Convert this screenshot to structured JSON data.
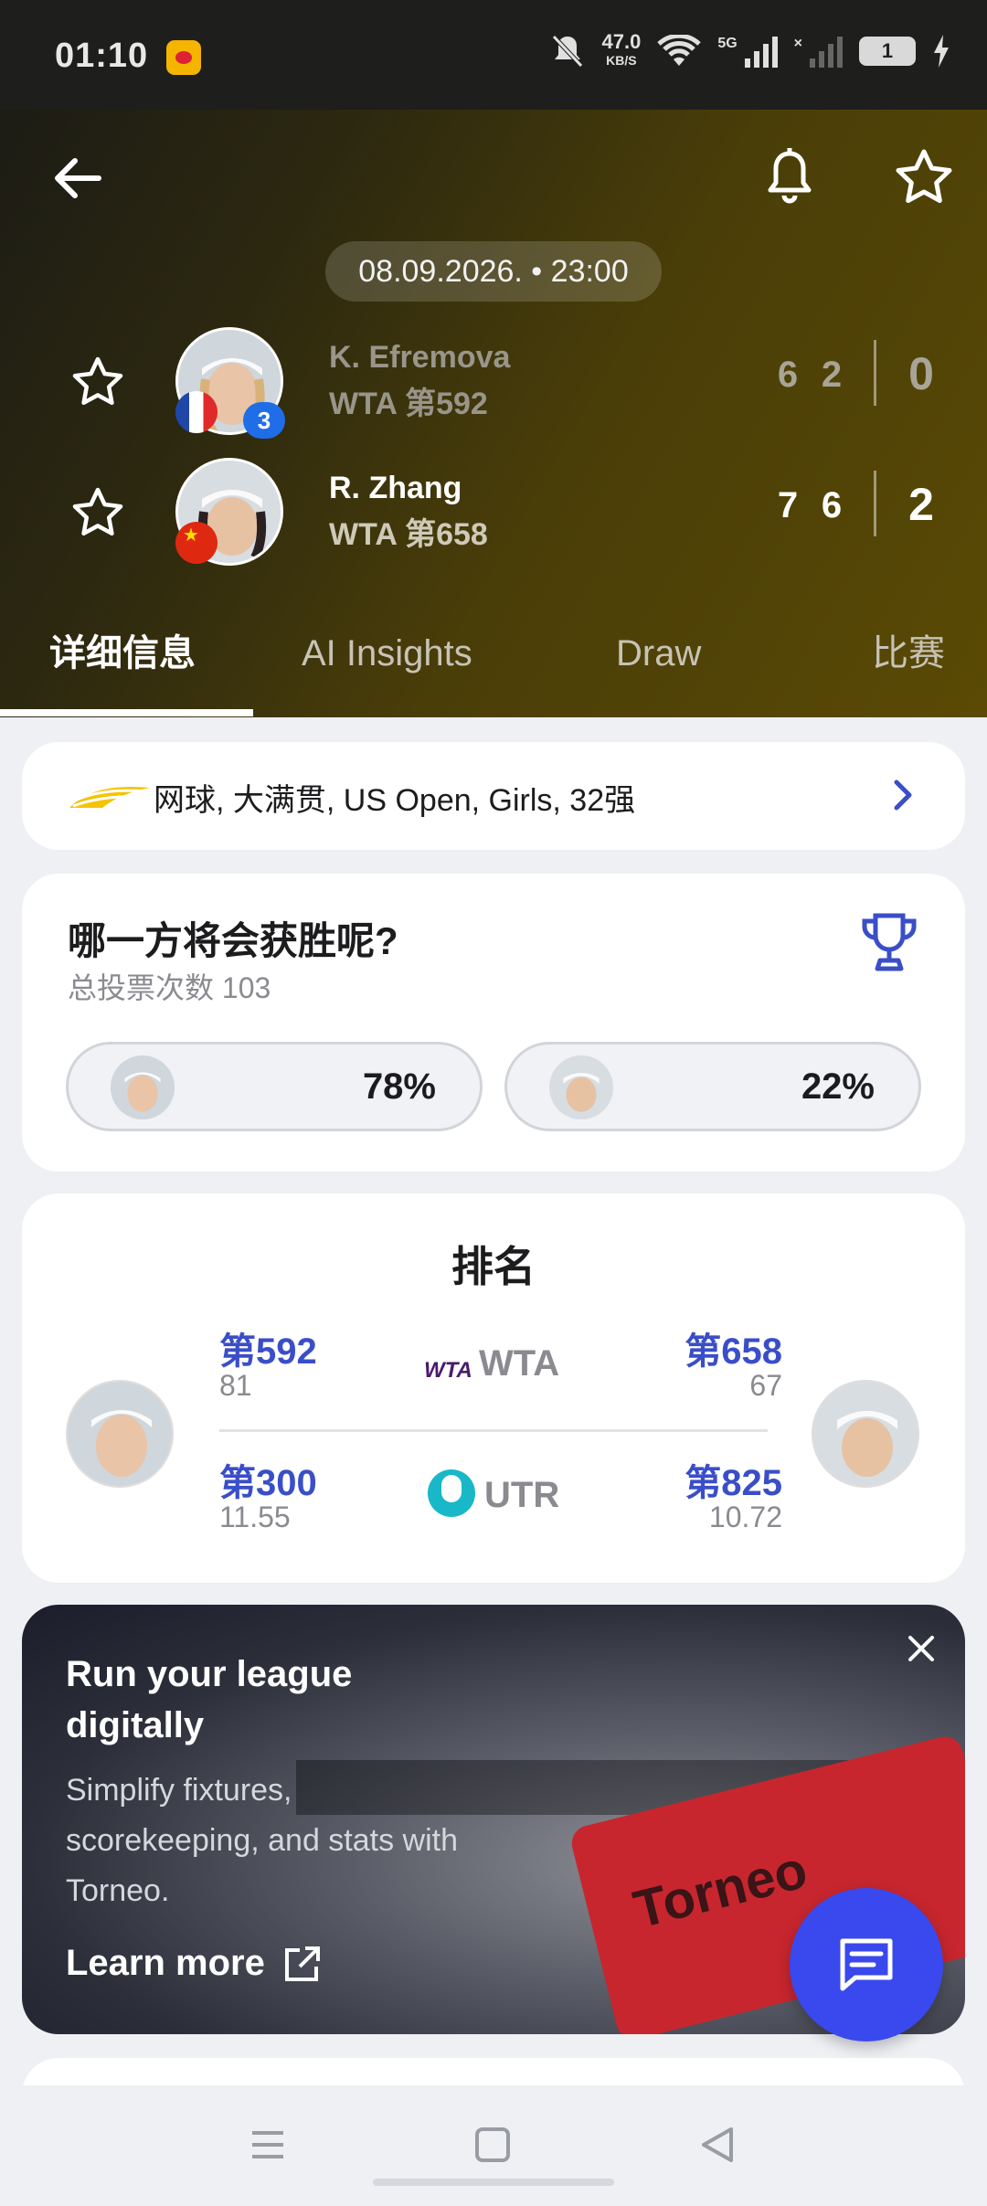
{
  "status_bar": {
    "time": "01:10",
    "net_speed": "47.0",
    "net_unit": "KB/S",
    "network": "5G",
    "battery": "1"
  },
  "header": {
    "date_time": "08.09.2026. • 23:00",
    "icons": [
      "back-arrow-icon",
      "bell-icon",
      "star-icon"
    ]
  },
  "match": {
    "players": [
      {
        "name": "K. Efremova",
        "rank": "WTA 第592",
        "flag": "FR",
        "seed": "3",
        "sets": [
          "6",
          "2"
        ],
        "game": "0"
      },
      {
        "name": "R. Zhang",
        "rank": "WTA 第658",
        "flag": "CN",
        "seed": "",
        "sets": [
          "7",
          "6"
        ],
        "game": "2"
      }
    ]
  },
  "tabs": [
    {
      "label": "详细信息",
      "active": true
    },
    {
      "label": "AI Insights",
      "active": false
    },
    {
      "label": "Draw",
      "active": false
    },
    {
      "label": "比赛",
      "active": false
    }
  ],
  "breadcrumb": {
    "text": "网球, 大满贯, US Open, Girls, 32强"
  },
  "vote": {
    "title": "哪一方将会获胜呢?",
    "total": "总投票次数 103",
    "options": [
      {
        "percent": "78%"
      },
      {
        "percent": "22%"
      }
    ]
  },
  "ranking": {
    "title": "排名",
    "rows": [
      {
        "org": "WTA",
        "left_rank": "第592",
        "left_points": "81",
        "right_rank": "第658",
        "right_points": "67"
      },
      {
        "org": "UTR",
        "left_rank": "第300",
        "left_points": "11.55",
        "right_rank": "第825",
        "right_points": "10.72"
      }
    ]
  },
  "ad": {
    "title": "Run your league digitally",
    "body": "Simplify fixtures, scorekeeping, and stats with Torneo.",
    "cta": "Learn more",
    "brand": "Torneo"
  },
  "colors": {
    "accent": "#3949ee",
    "rank_blue": "#3a4ec8",
    "header_gold": "#5a4a05"
  }
}
